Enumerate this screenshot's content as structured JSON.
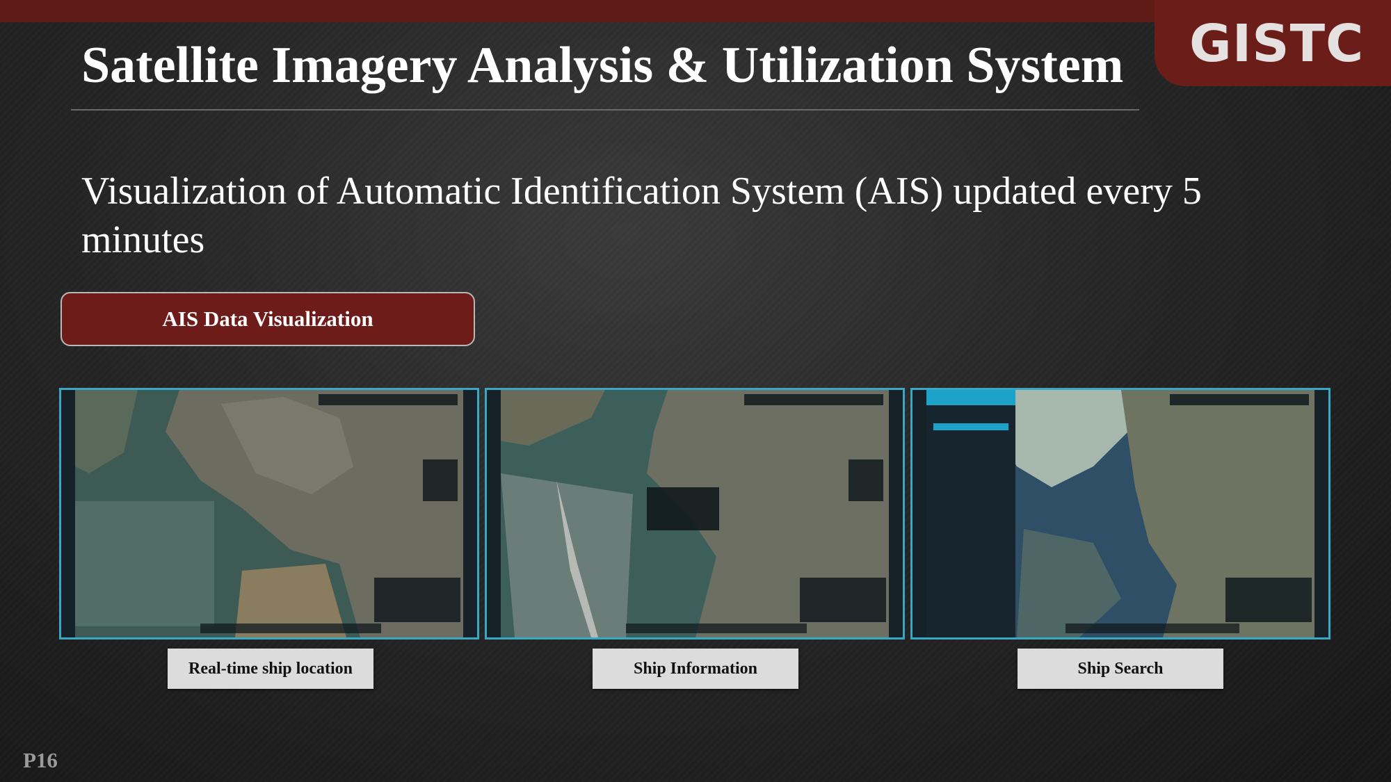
{
  "slide": {
    "title": "Satellite Imagery Analysis & Utilization System",
    "logo_text": "GISTC",
    "subtitle": "Visualization of Automatic Identification System (AIS) updated every 5 minutes",
    "section_badge": "AIS Data Visualization",
    "page_number": "P16"
  },
  "screenshots": [
    {
      "label": "Real-time ship location",
      "panel": "none"
    },
    {
      "label": "Ship Information",
      "panel": "info-popup"
    },
    {
      "label": "Ship Search",
      "panel": "search-sidebar"
    }
  ],
  "colors": {
    "brand_red": "#6e1c19",
    "screen_border": "#3aa7c3",
    "label_bg": "#dcdcdc",
    "map_sea": "#3d5a55",
    "map_land": "#6e7062"
  }
}
